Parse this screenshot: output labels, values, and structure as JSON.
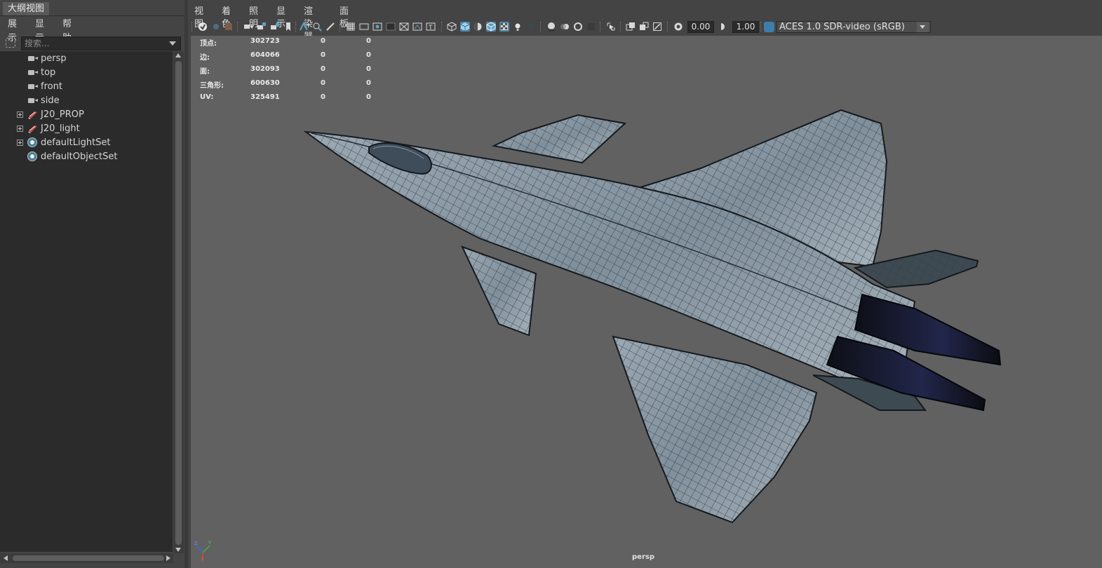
{
  "outliner": {
    "tab_title": "大纲视图",
    "menu": [
      "展示",
      "显示",
      "帮助"
    ],
    "search_placeholder": "搜索...",
    "items": [
      {
        "label": "persp",
        "kind": "camera"
      },
      {
        "label": "top",
        "kind": "camera"
      },
      {
        "label": "front",
        "kind": "camera"
      },
      {
        "label": "side",
        "kind": "camera"
      },
      {
        "label": "J20_PROP",
        "kind": "group"
      },
      {
        "label": "J20_light",
        "kind": "group"
      },
      {
        "label": "defaultLightSet",
        "kind": "set"
      },
      {
        "label": "defaultObjectSet",
        "kind": "set"
      }
    ]
  },
  "panel": {
    "menu": [
      "视图",
      "着色",
      "照明",
      "显示",
      "渲染器",
      "面板"
    ],
    "toolbar": {
      "exposure": "0.00",
      "gamma": "1.00",
      "color_space": "ACES 1.0 SDR-video (sRGB)",
      "accent": "#5285a6"
    }
  },
  "hud": {
    "rows": [
      {
        "label": "顶点:",
        "v1": "302723",
        "v2": "0",
        "v3": "0"
      },
      {
        "label": "边:",
        "v1": "604066",
        "v2": "0",
        "v3": "0"
      },
      {
        "label": "面:",
        "v1": "302093",
        "v2": "0",
        "v3": "0"
      },
      {
        "label": "三角形:",
        "v1": "600630",
        "v2": "0",
        "v3": "0"
      },
      {
        "label": "UV:",
        "v1": "325491",
        "v2": "0",
        "v3": "0"
      }
    ]
  },
  "viewport": {
    "camera_name": "persp",
    "background": "#616161"
  }
}
